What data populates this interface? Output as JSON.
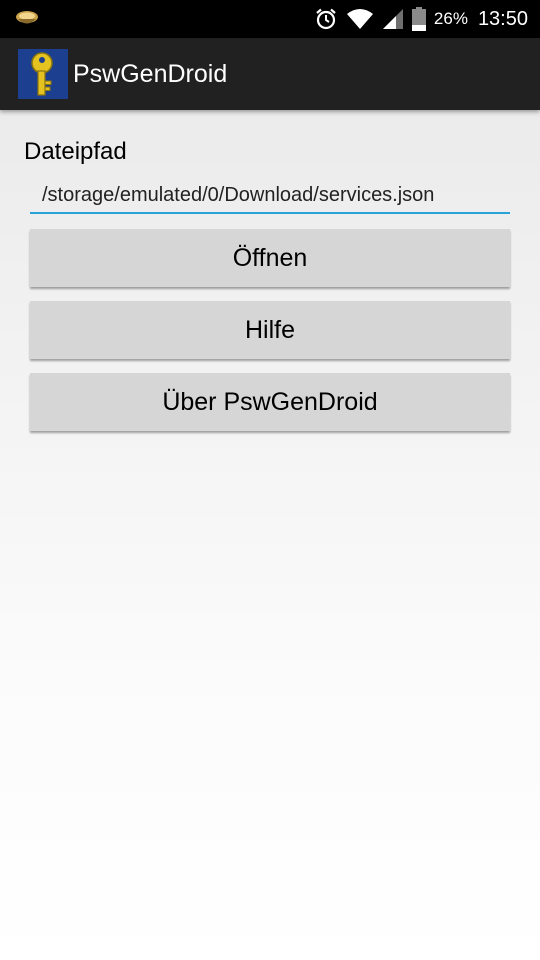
{
  "status_bar": {
    "notification_icon": "app-notification-icon",
    "alarm_icon": "alarm-clock-icon",
    "wifi_icon": "wifi-icon",
    "signal_icon": "cell-signal-icon",
    "battery_icon": "battery-icon",
    "battery_level": "26%",
    "time": "13:50"
  },
  "app_bar": {
    "icon": "key-icon",
    "title": "PswGenDroid",
    "background": "#212121"
  },
  "form": {
    "label": "Dateipfad",
    "path_value": "/storage/emulated/0/Download/services.json",
    "accent": "#2aa4d8"
  },
  "buttons": {
    "open": "Öffnen",
    "help": "Hilfe",
    "about": "Über PswGenDroid",
    "background": "#d6d6d6"
  }
}
